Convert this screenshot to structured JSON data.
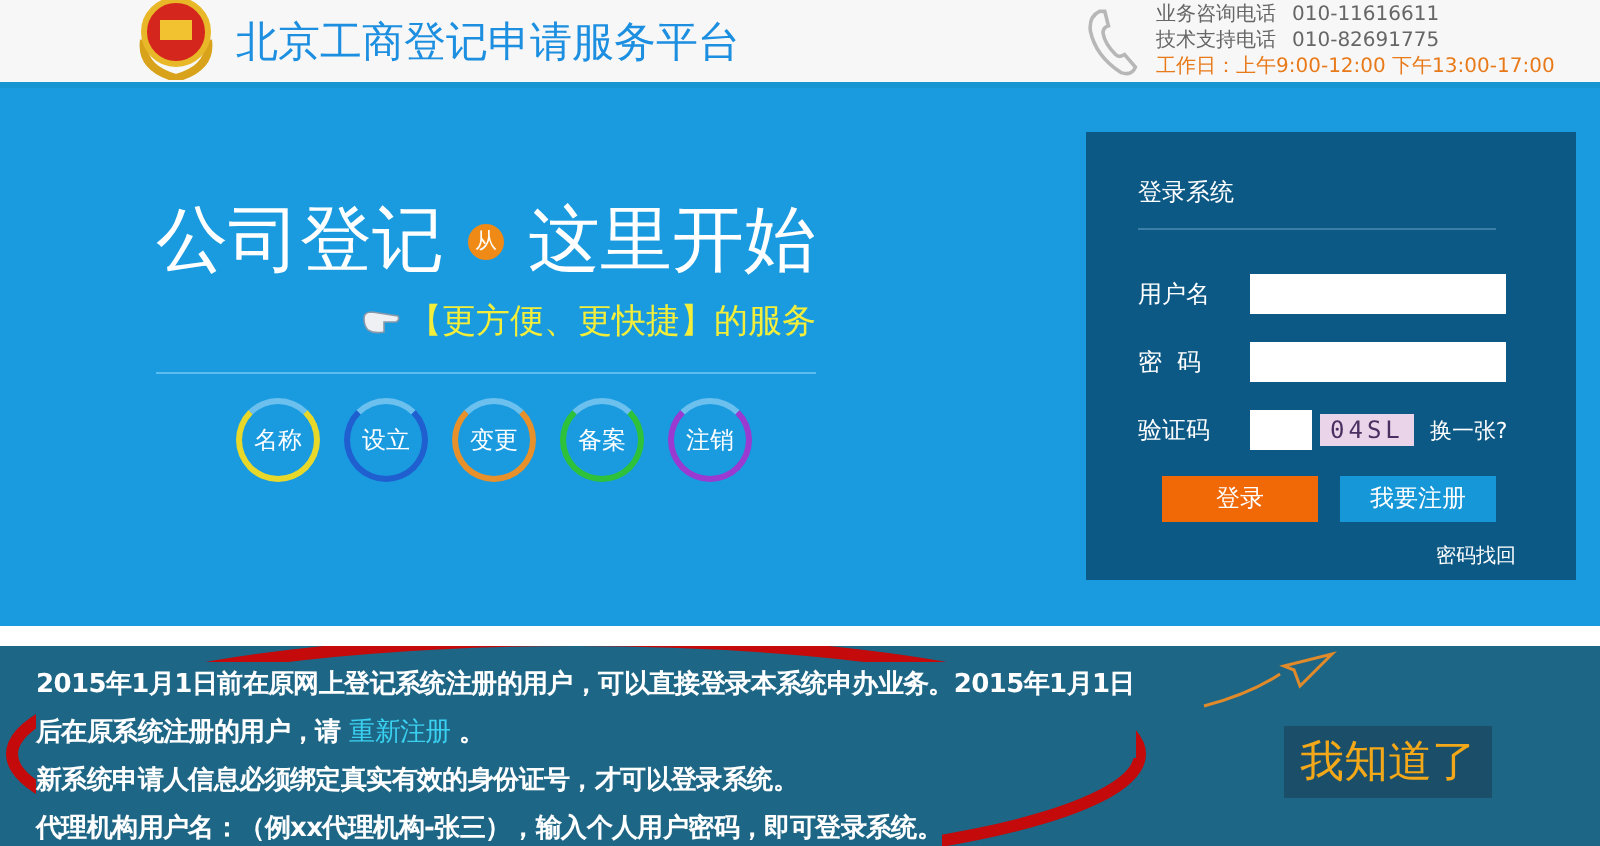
{
  "header": {
    "title": "北京工商登记申请服务平台",
    "contact": [
      {
        "label": "业务咨询电话",
        "value": "010-11616611"
      },
      {
        "label": "技术支持电话",
        "value": "010-82691775"
      }
    ],
    "hours": "工作日：上午9:00-12:00  下午13:00-17:00"
  },
  "hero": {
    "headline_left": "公司登记",
    "badge": "从",
    "headline_right": "这里开始",
    "tagline": "【更方便、更快捷】的服务",
    "services": [
      {
        "label": "名称",
        "color": "#e8d82a"
      },
      {
        "label": "设立",
        "color": "#1f5fd0"
      },
      {
        "label": "变更",
        "color": "#e8902a"
      },
      {
        "label": "备案",
        "color": "#2ec23a"
      },
      {
        "label": "注销",
        "color": "#9a3ad0"
      }
    ]
  },
  "login": {
    "title": "登录系统",
    "fields": [
      {
        "kind": "text",
        "label": "用户名"
      },
      {
        "kind": "password",
        "label": "密  码"
      },
      {
        "kind": "captcha",
        "label": "验证码",
        "captcha": "04SL",
        "refresh": "换一张?"
      }
    ],
    "buttons": [
      {
        "kind": "primary",
        "label": "登录"
      },
      {
        "kind": "secondary",
        "label": "我要注册"
      }
    ],
    "forgot": "密码找回"
  },
  "notice": {
    "paragraphs": [
      {
        "text": "2015年1月1日前在原网上登记系统注册的用户，可以直接登录本系统申办业务。2015年1月1日后在原系统注册的用户，请 ",
        "link": "重新注册",
        "after": " 。"
      },
      {
        "text": "新系统申请人信息必须绑定真实有效的身份证号，才可以登录系统。"
      },
      {
        "text": "代理机构用户名：（例xx代理机构-张三），输入个人用户密码，即可登录系统。"
      }
    ],
    "dismiss": "我知道了"
  }
}
